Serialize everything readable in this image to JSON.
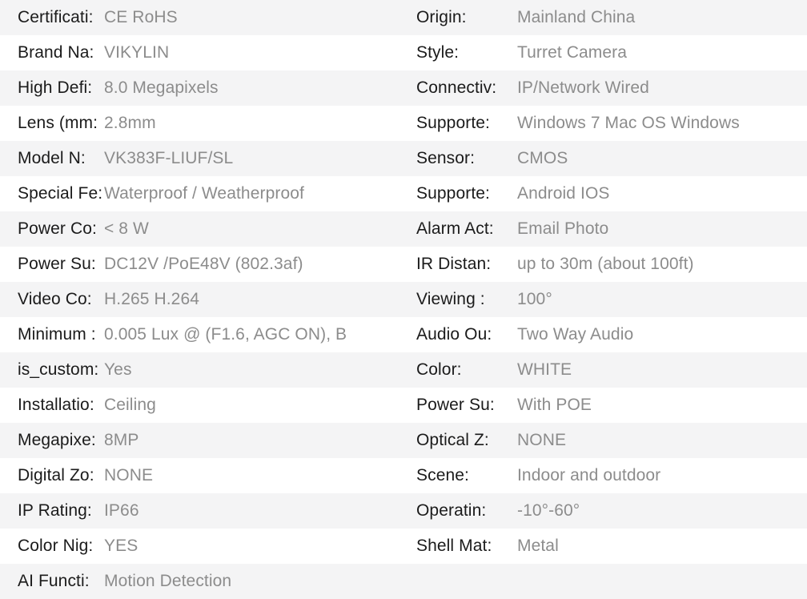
{
  "spec_sheet": {
    "columns": 2,
    "row_count": 16,
    "colors": {
      "label_text": "#1b1b1b",
      "value_text": "#8c8c8c",
      "stripe_gray": "#f4f4f5",
      "stripe_white": "#ffffff"
    },
    "rows": [
      {
        "left": {
          "label": "Certificati:",
          "value": "CE RoHS"
        },
        "right": {
          "label": "Origin:",
          "value": "Mainland China"
        }
      },
      {
        "left": {
          "label": "Brand Na:",
          "value": "VIKYLIN"
        },
        "right": {
          "label": "Style:",
          "value": "Turret Camera"
        }
      },
      {
        "left": {
          "label": "High Defi:",
          "value": "8.0 Megapixels"
        },
        "right": {
          "label": "Connectiv:",
          "value": "IP/Network Wired"
        }
      },
      {
        "left": {
          "label": "Lens (mm:",
          "value": "2.8mm"
        },
        "right": {
          "label": "Supporte:",
          "value": "Windows 7 Mac OS Windows"
        }
      },
      {
        "left": {
          "label": "Model N:",
          "value": "VK383F-LIUF/SL"
        },
        "right": {
          "label": "Sensor:",
          "value": "CMOS"
        }
      },
      {
        "left": {
          "label": "Special Fe:",
          "value": "Waterproof / Weatherproof"
        },
        "right": {
          "label": "Supporte:",
          "value": "Android IOS"
        }
      },
      {
        "left": {
          "label": "Power Co:",
          "value": "< 8 W"
        },
        "right": {
          "label": "Alarm Act:",
          "value": "Email Photo"
        }
      },
      {
        "left": {
          "label": "Power Su:",
          "value": "DC12V /PoE48V (802.3af)"
        },
        "right": {
          "label": "IR Distan:",
          "value": "up to 30m (about 100ft)"
        }
      },
      {
        "left": {
          "label": "Video Co:",
          "value": "H.265 H.264"
        },
        "right": {
          "label": "Viewing :",
          "value": "100°"
        }
      },
      {
        "left": {
          "label": "Minimum :",
          "value": "0.005 Lux @ (F1.6, AGC ON), B"
        },
        "right": {
          "label": "Audio Ou:",
          "value": "Two Way Audio"
        }
      },
      {
        "left": {
          "label": "is_custom:",
          "value": "Yes"
        },
        "right": {
          "label": "Color:",
          "value": "WHITE"
        }
      },
      {
        "left": {
          "label": "Installatio:",
          "value": "Ceiling"
        },
        "right": {
          "label": "Power Su:",
          "value": "With POE"
        }
      },
      {
        "left": {
          "label": "Megapixe:",
          "value": "8MP"
        },
        "right": {
          "label": "Optical Z:",
          "value": "NONE"
        }
      },
      {
        "left": {
          "label": "Digital Zo:",
          "value": "NONE"
        },
        "right": {
          "label": "Scene:",
          "value": "Indoor and outdoor"
        }
      },
      {
        "left": {
          "label": "IP Rating:",
          "value": "IP66"
        },
        "right": {
          "label": "Operatin:",
          "value": "-10°-60°"
        }
      },
      {
        "left": {
          "label": "Color Nig:",
          "value": "YES"
        },
        "right": {
          "label": "Shell Mat:",
          "value": "Metal"
        }
      },
      {
        "left": {
          "label": "AI Functi:",
          "value": "Motion Detection"
        },
        "right": {
          "label": "",
          "value": ""
        }
      }
    ]
  }
}
